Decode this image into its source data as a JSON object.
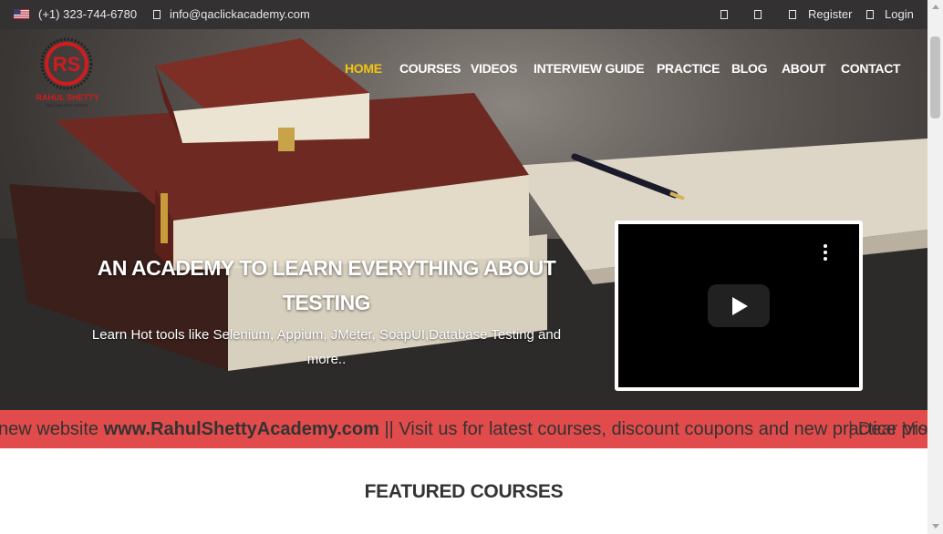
{
  "topbar": {
    "phone": "(+1) 323-744-6780",
    "email": "info@qaclickacademy.com",
    "register": "Register",
    "login": "Login"
  },
  "logo": {
    "text": "RAHUL SHETTY",
    "tagline": "BECOME SDET EXPERT"
  },
  "nav": {
    "items": [
      "HOME",
      "COURSES",
      "VIDEOS",
      "INTERVIEW GUIDE",
      "PRACTICE",
      "BLOG",
      "ABOUT",
      "CONTACT"
    ],
    "active": "HOME"
  },
  "hero": {
    "title_line1": "AN ACADEMY TO LEARN EVERYTHING ABOUT",
    "title_line2": "TESTING",
    "subtitle_line1": "Learn Hot tools like Selenium, Appium, JMeter, SoapUI,Database Testing and",
    "subtitle_line2": "more.."
  },
  "marquee": {
    "prefix": "new website ",
    "site": "www.RahulShettyAcademy.com",
    "suffix": " || Visit us for latest courses, discount coupons and new practice projects",
    "overlap": "| Dear Vis"
  },
  "featured": {
    "heading": "FEATURED COURSES"
  },
  "colors": {
    "topbar_bg": "#333131",
    "nav_active": "#f1c40f",
    "marquee_bg": "#e24b4b",
    "logo_red": "#d01c1f"
  }
}
